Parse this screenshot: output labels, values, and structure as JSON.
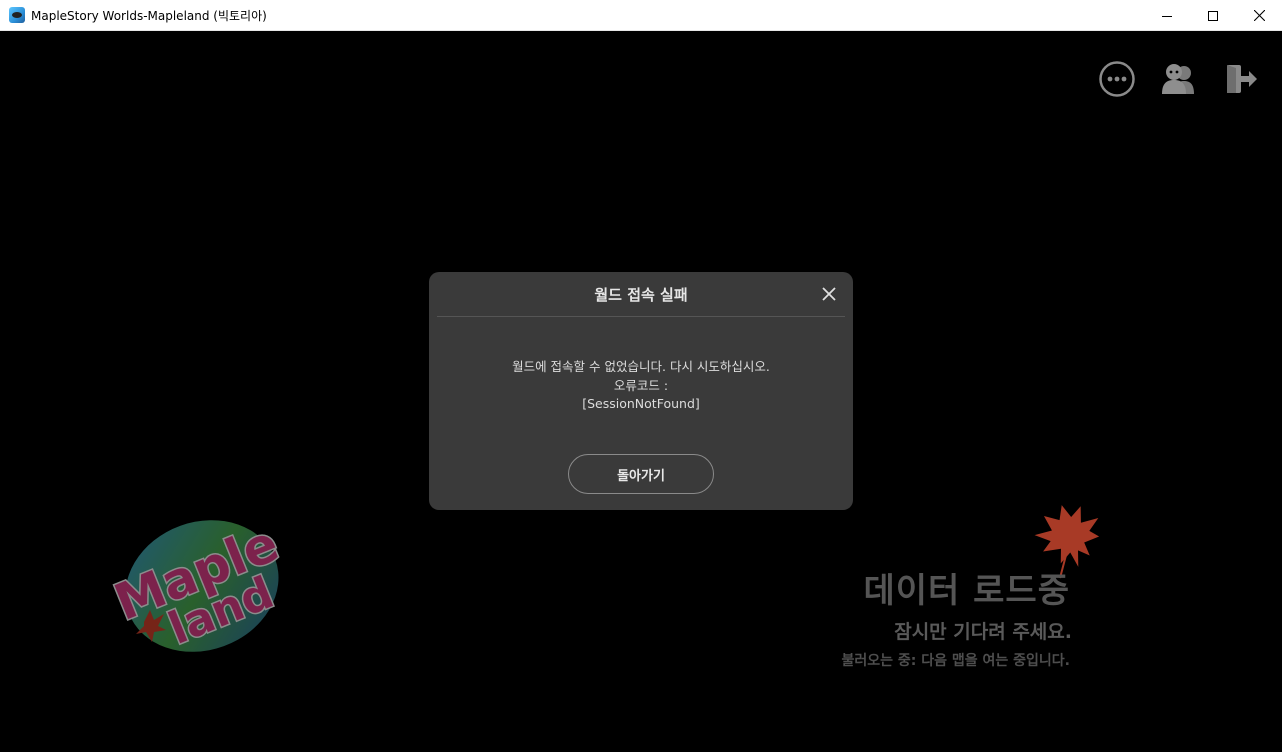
{
  "window": {
    "title": "MapleStory Worlds-Mapleland (빅토리아)"
  },
  "top_icons": [
    {
      "name": "more-options-icon"
    },
    {
      "name": "friends-icon"
    },
    {
      "name": "exit-icon"
    }
  ],
  "dialog": {
    "title": "월드 접속 실패",
    "message_line1": "월드에 접속할 수 없었습니다. 다시 시도하십시오.",
    "message_line2": "오류코드 :",
    "message_line3": "[SessionNotFound]",
    "button_label": "돌아가기"
  },
  "logo": {
    "line1": "Maple",
    "line2": "land"
  },
  "loading": {
    "title": "데이터 로드중",
    "subtitle": "잠시만 기다려 주세요.",
    "status": "불러오는 중: 다음 맵을 여는 중입니다."
  },
  "colors": {
    "dialog_bg": "#3a3a3a",
    "leaf": "#a83a26"
  }
}
